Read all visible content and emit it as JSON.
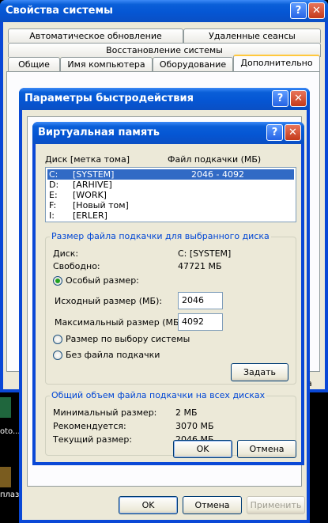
{
  "desktop": {
    "label1": "oto...",
    "label2": "плаз"
  },
  "system_window": {
    "title": "Свойства системы",
    "tabs_row1": [
      "Автоматическое обновление",
      "Удаленные сеансы"
    ],
    "tabs_row2": [
      "Восстановление системы"
    ],
    "tabs_row3": [
      "Общие",
      "Имя компьютера",
      "Оборудование",
      "Дополнительно"
    ],
    "active_tab": "Дополнительно",
    "help_glyph": "?",
    "close_glyph": "✕",
    "bottom_fragment": "а"
  },
  "perf_window": {
    "title": "Параметры быстродействия",
    "help_glyph": "?",
    "close_glyph": "✕",
    "ok": "OK",
    "cancel": "Отмена",
    "apply": "Применить"
  },
  "vm_window": {
    "title": "Виртуальная память",
    "help_glyph": "?",
    "close_glyph": "✕",
    "col_drive": "Диск [метка тома]",
    "col_pagefile": "Файл подкачки (МБ)",
    "drives": [
      {
        "letter": "C:",
        "label": "[SYSTEM]",
        "size": "2046 - 4092",
        "selected": true
      },
      {
        "letter": "D:",
        "label": "[ARHIVE]",
        "size": "",
        "selected": false
      },
      {
        "letter": "E:",
        "label": "[WORK]",
        "size": "",
        "selected": false
      },
      {
        "letter": "F:",
        "label": "[Новый том]",
        "size": "",
        "selected": false
      },
      {
        "letter": "I:",
        "label": "[ERLER]",
        "size": "",
        "selected": false
      }
    ],
    "selected_group": {
      "title": "Размер файла подкачки для выбранного диска",
      "disk_label": "Диск:",
      "disk_value": "C:  [SYSTEM]",
      "free_label": "Свободно:",
      "free_value": "47721 МБ",
      "custom_label": "Особый размер:",
      "initial_label": "Исходный размер (МБ):",
      "initial_value": "2046",
      "max_label": "Максимальный размер (МБ):",
      "max_value": "4092",
      "system_label": "Размер по выбору системы",
      "none_label": "Без файла подкачки",
      "set_button": "Задать",
      "selected_option": "custom"
    },
    "total_group": {
      "title": "Общий объем файла подкачки на всех дисках",
      "min_label": "Минимальный размер:",
      "min_value": "2 МБ",
      "rec_label": "Рекомендуется:",
      "rec_value": "3070 МБ",
      "cur_label": "Текущий размер:",
      "cur_value": "2046 МБ"
    },
    "ok": "OK",
    "cancel": "Отмена"
  }
}
